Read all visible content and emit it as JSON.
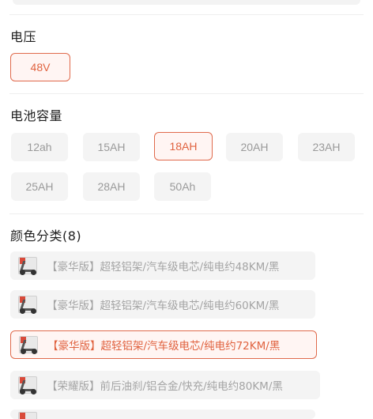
{
  "voltage": {
    "title": "电压",
    "options": [
      {
        "label": "48V",
        "selected": true
      }
    ]
  },
  "battery": {
    "title": "电池容量",
    "options": [
      {
        "label": "12ah",
        "selected": false
      },
      {
        "label": "15AH",
        "selected": false
      },
      {
        "label": "18AH",
        "selected": true
      },
      {
        "label": "20AH",
        "selected": false
      },
      {
        "label": "23AH",
        "selected": false
      },
      {
        "label": "25AH",
        "selected": false
      },
      {
        "label": "28AH",
        "selected": false
      },
      {
        "label": "50Ah",
        "selected": false
      }
    ]
  },
  "colors": {
    "title": "颜色分类(8)",
    "options": [
      {
        "label": "【豪华版】超轻铝架/汽车级电芯/纯电约48KM/黑",
        "selected": false,
        "icon": "scooter-thumbnail-icon"
      },
      {
        "label": "【豪华版】超轻铝架/汽车级电芯/纯电约60KM/黑",
        "selected": false,
        "icon": "scooter-thumbnail-icon"
      },
      {
        "label": "【豪华版】超轻铝架/汽车级电芯/纯电约72KM/黑",
        "selected": true,
        "icon": "scooter-thumbnail-icon"
      },
      {
        "label": "【荣耀版】前后油刹/铝合金/快充/纯电约80KM/黑",
        "selected": false,
        "icon": "scooter-thumbnail-icon"
      }
    ]
  },
  "theme": {
    "accent": "#e0623f",
    "chip_bg": "#f4f4f4",
    "selected_bg": "#fff5f3"
  }
}
